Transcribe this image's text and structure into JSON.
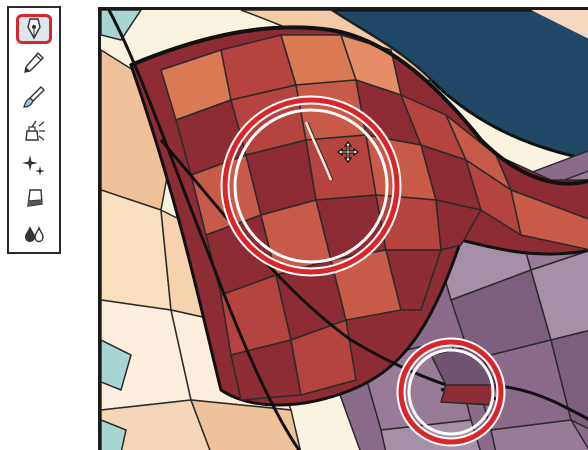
{
  "toolbar": {
    "tools": [
      {
        "icon": "pen-nib-icon",
        "active": true
      },
      {
        "icon": "pencil-icon",
        "active": false
      },
      {
        "icon": "brush-icon",
        "active": false
      },
      {
        "icon": "ink-pot-icon",
        "active": false
      },
      {
        "icon": "sparkle-icon",
        "active": false
      },
      {
        "icon": "eraser-icon",
        "active": false
      },
      {
        "icon": "fill-drops-icon",
        "active": false
      }
    ]
  },
  "colors": {
    "highlight": "#d8262b",
    "dark_red": "#8e2c35",
    "mid_red": "#b5443e",
    "orange": "#d97a55",
    "peach": "#f0c29a",
    "cream": "#fbf3e2",
    "purple": "#8a6c8a",
    "light_purple": "#a690a8",
    "navy": "#1f4766",
    "teal": "#a8d4d2"
  }
}
